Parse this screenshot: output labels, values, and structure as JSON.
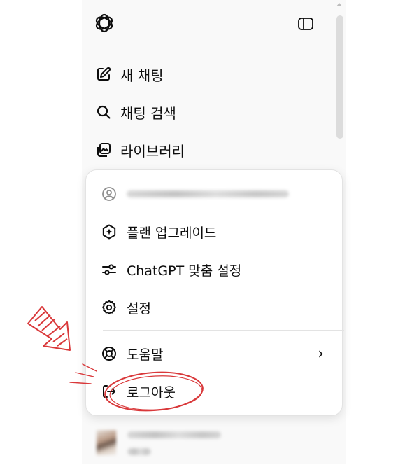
{
  "sidebar": {
    "nav": [
      {
        "label": "새 채팅",
        "icon": "edit-icon"
      },
      {
        "label": "채팅 검색",
        "icon": "search-icon"
      },
      {
        "label": "라이브러리",
        "icon": "library-icon"
      }
    ]
  },
  "menu": {
    "items": [
      {
        "label": "플랜 업그레이드",
        "icon": "upgrade-icon"
      },
      {
        "label": "ChatGPT 맞춤 설정",
        "icon": "sliders-icon"
      },
      {
        "label": "설정",
        "icon": "gear-icon"
      },
      {
        "label": "도움말",
        "icon": "lifebuoy-icon"
      },
      {
        "label": "로그아웃",
        "icon": "logout-icon"
      }
    ],
    "help_chevron": "›"
  },
  "colors": {
    "sidebar_bg": "#f9f9f9",
    "menu_bg": "#ffffff",
    "annotation_red": "#d9383a"
  }
}
